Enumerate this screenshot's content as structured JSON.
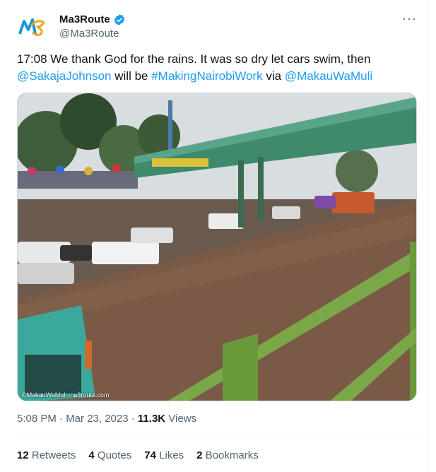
{
  "tweet": {
    "display_name": "Ma3Route",
    "handle": "@Ma3Route",
    "more_label": "···",
    "text_time": "17:08 We thank God for the rains. It was so dry let cars swim, then",
    "mention_1": "@SakajaJohnson",
    "text_will_be": " will be ",
    "hashtag": "#MakingNairobiWork",
    "text_via": " via ",
    "mention_2": "@MakauWaMuli",
    "watermark": "©MakauWaMuli ma3route.com",
    "timestamp": "5:08 PM · Mar 23, 2023 · ",
    "views_count": "11.3K",
    "views_label": " Views"
  },
  "stats": {
    "retweets_count": "12",
    "retweets_label": "Retweets",
    "quotes_count": "4",
    "quotes_label": "Quotes",
    "likes_count": "74",
    "likes_label": "Likes",
    "bookmarks_count": "2",
    "bookmarks_label": "Bookmarks"
  },
  "colors": {
    "link": "#1d9bf0",
    "verified": "#1d9bf0",
    "text": "#0f1419",
    "muted": "#536471"
  },
  "icons": {
    "verified": "verified-badge-icon",
    "logo": "ma3route-logo-icon"
  }
}
